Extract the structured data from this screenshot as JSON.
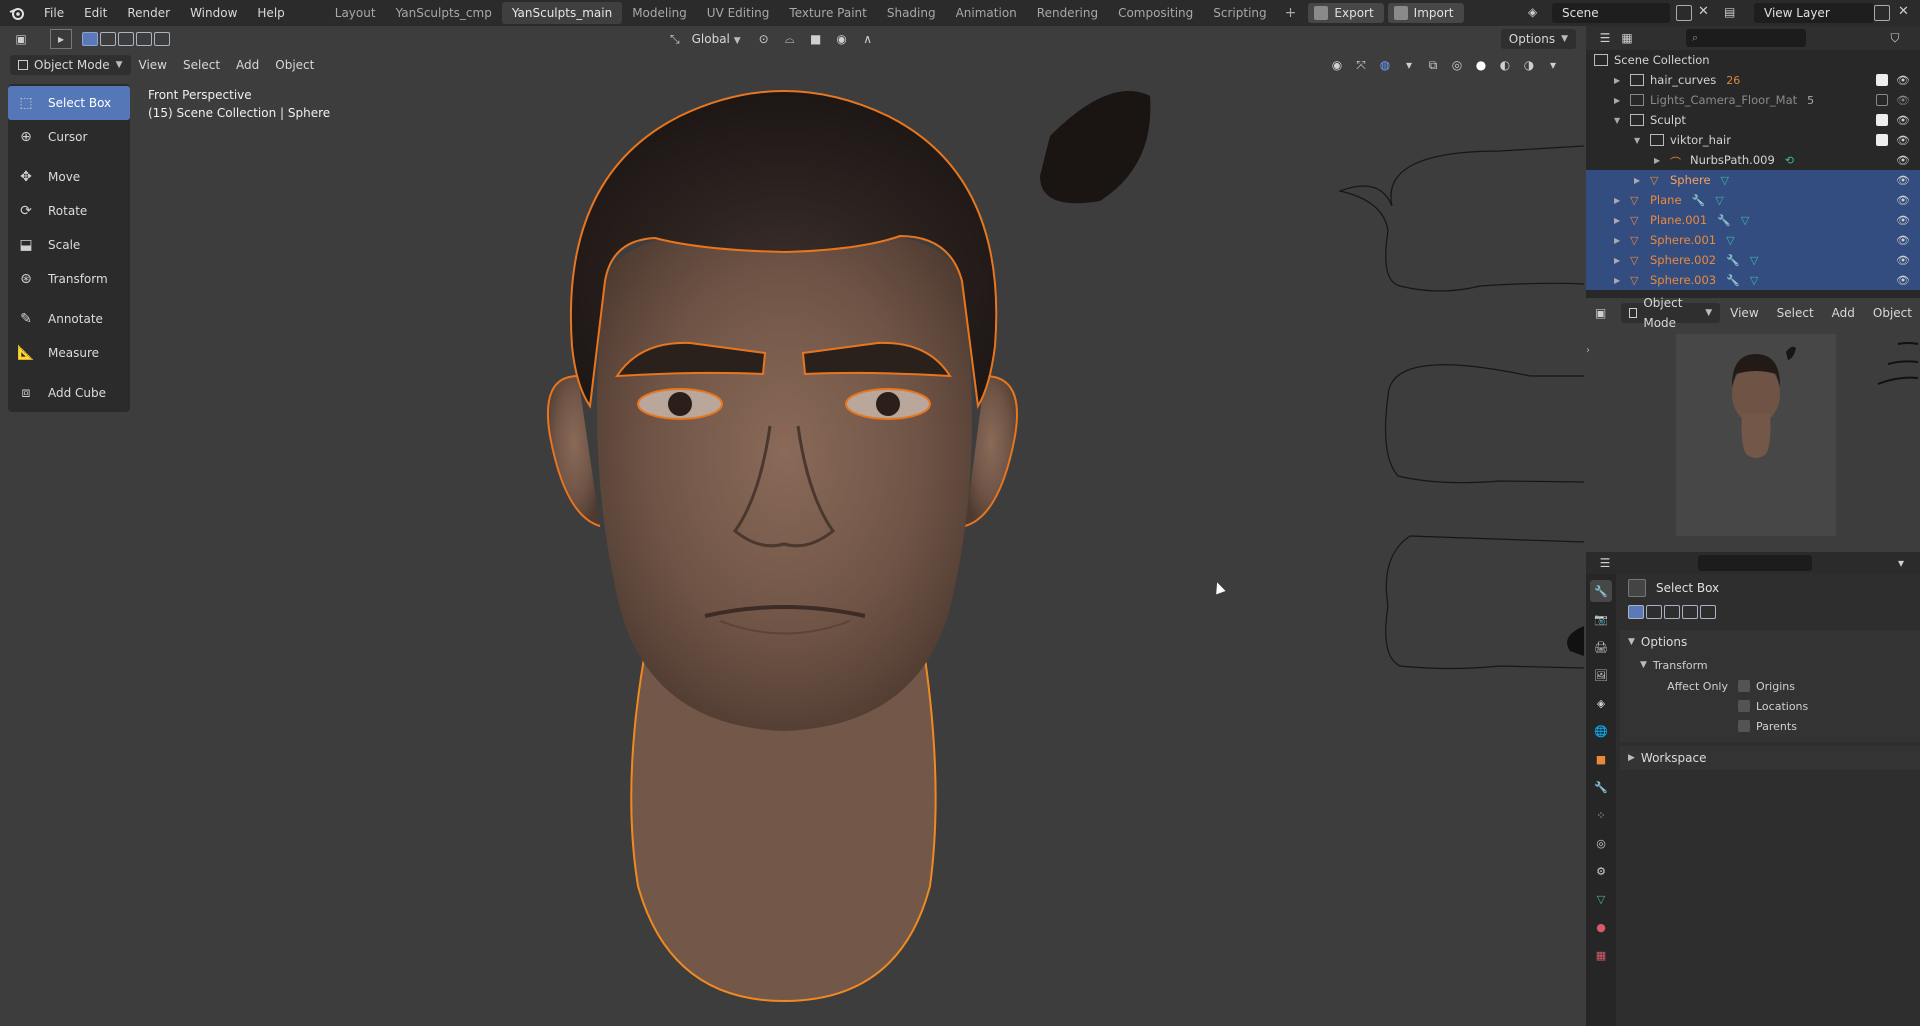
{
  "menu": {
    "items": [
      "File",
      "Edit",
      "Render",
      "Window",
      "Help"
    ]
  },
  "workspaces": {
    "tabs": [
      "Layout",
      "YanSculpts_cmp",
      "YanSculpts_main",
      "Modeling",
      "UV Editing",
      "Texture Paint",
      "Shading",
      "Animation",
      "Rendering",
      "Compositing",
      "Scripting"
    ],
    "active": "YanSculpts_main",
    "export_label": "Export",
    "import_label": "Import"
  },
  "scene": {
    "name": "Scene",
    "view_layer": "View Layer"
  },
  "viewport": {
    "transform_orientation": "Global",
    "options_label": "Options",
    "mode": "Object Mode",
    "header_menus": [
      "View",
      "Select",
      "Add",
      "Object"
    ],
    "info_line1": "Front Perspective",
    "info_line2": "(15) Scene Collection | Sphere"
  },
  "tools": [
    {
      "label": "Select Box",
      "icon": "select-box-icon",
      "active": true
    },
    {
      "label": "Cursor",
      "icon": "cursor-icon"
    },
    {
      "label": "Move",
      "icon": "move-icon"
    },
    {
      "label": "Rotate",
      "icon": "rotate-icon"
    },
    {
      "label": "Scale",
      "icon": "scale-icon"
    },
    {
      "label": "Transform",
      "icon": "transform-icon"
    },
    {
      "label": "Annotate",
      "icon": "annotate-icon"
    },
    {
      "label": "Measure",
      "icon": "measure-icon"
    },
    {
      "label": "Add Cube",
      "icon": "add-cube-icon"
    }
  ],
  "outliner": {
    "root": "Scene Collection",
    "rows": [
      {
        "name": "hair_curves",
        "extra": "26"
      },
      {
        "name": "Lights_Camera_Floor_Mat",
        "extra": "5"
      },
      {
        "name": "Sculpt"
      },
      {
        "name": "viktor_hair"
      },
      {
        "name": "NurbsPath.009"
      },
      {
        "name": "Sphere"
      },
      {
        "name": "Plane"
      },
      {
        "name": "Plane.001"
      },
      {
        "name": "Sphere.001"
      },
      {
        "name": "Sphere.002"
      },
      {
        "name": "Sphere.003"
      }
    ]
  },
  "preview": {
    "mode": "Object Mode",
    "menus": [
      "View",
      "Select",
      "Add",
      "Object"
    ]
  },
  "properties": {
    "tool_name": "Select Box",
    "options_label": "Options",
    "transform_label": "Transform",
    "affect_only_label": "Affect Only",
    "affect": [
      "Origins",
      "Locations",
      "Parents"
    ],
    "workspace_label": "Workspace"
  },
  "colors": {
    "accent": "#5477b8",
    "selection_outline": "#e8761e",
    "outliner_selected": "#334d80"
  }
}
